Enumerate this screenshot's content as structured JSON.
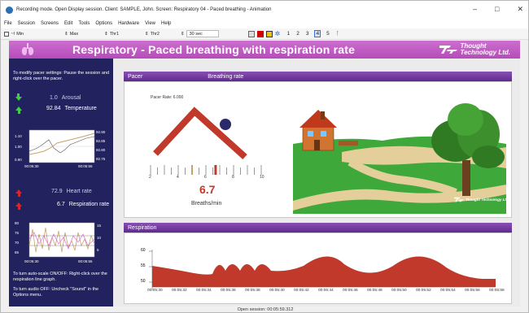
{
  "window": {
    "title": "Recording mode. Open Display session. Client: SAMPLE, John. Screen: Respiratory 04 - Paced breathing - Animation",
    "controls": [
      "–",
      "□",
      "✕"
    ]
  },
  "menu": [
    "File",
    "Session",
    "Screens",
    "Edit",
    "Tools",
    "Options",
    "Hardware",
    "View",
    "Help"
  ],
  "toolbar": {
    "min_label": "Min",
    "max_label": "Max",
    "thr1_label": "Thr1",
    "thr2_label": "Thr2",
    "time_value": "30 sec",
    "screen_numbers": [
      "1",
      "2",
      "3",
      "4",
      "5"
    ],
    "active_screen": "4"
  },
  "header": {
    "title": "Respiratory - Paced breathing with respiration rate",
    "brand_line1": "Thought",
    "brand_line2": "Technology Ltd."
  },
  "left_panel": {
    "instructions": "To modify pacer settings: Pause the session and right-click over the pacer.",
    "arousal_value": "1.0",
    "arousal_label": "Arousal",
    "temperature_value": "92.84",
    "temperature_label": "Temperature",
    "temp_chart": {
      "y_left": [
        "1.10",
        "1.00",
        "0.90"
      ],
      "y_right": [
        "92.90",
        "92.85",
        "92.80",
        "92.75"
      ],
      "x_ticks": [
        "00:05:30",
        "00:05:55"
      ]
    },
    "heart_rate_value": "72.9",
    "heart_rate_label": "Heart rate",
    "resp_rate_value": "6.7",
    "resp_rate_label": "Respiration rate",
    "hr_chart": {
      "y_left": [
        "80",
        "75",
        "70",
        "65"
      ],
      "y_right": [
        "15",
        "10",
        "5"
      ],
      "x_ticks": [
        "00:05:30",
        "00:05:55"
      ]
    },
    "note_autoscale": "To turn auto-scale ON/OFF: Right-click over the respiration line graph.",
    "note_audio": "To turn audio OFF: Uncheck \"Sound\" in the Options menu."
  },
  "pacer_panel": {
    "tab_pacer": "Pacer",
    "tab_breathing": "Breathing rate",
    "pacer_rate": "Pacer Rate: 6.000",
    "scale_ticks": [
      "2",
      "4",
      "6",
      "8",
      "10"
    ],
    "breathing_value": "6.7",
    "breathing_unit": "Breaths/min",
    "breathing_value_num": 6.7,
    "scene_logo": "Thought Technology Ltd."
  },
  "respiration_panel": {
    "title": "Respiration",
    "y_ticks": [
      "60",
      "55",
      "50"
    ],
    "x_ticks": [
      "00:05:30",
      "00:05:32",
      "00:05:34",
      "00:05:36",
      "00:05:38",
      "00:05:40",
      "00:05:42",
      "00:05:44",
      "00:05:46",
      "00:05:48",
      "00:05:50",
      "00:05:52",
      "00:05:54",
      "00:05:56",
      "00:05:58"
    ]
  },
  "status": {
    "text": "Open session: 00:05:59.312"
  },
  "colors": {
    "header_purple": "#b54cb9",
    "left_navy": "#22235e",
    "accent_red": "#c0392b",
    "pacer_ball": "#2a2a6b"
  }
}
